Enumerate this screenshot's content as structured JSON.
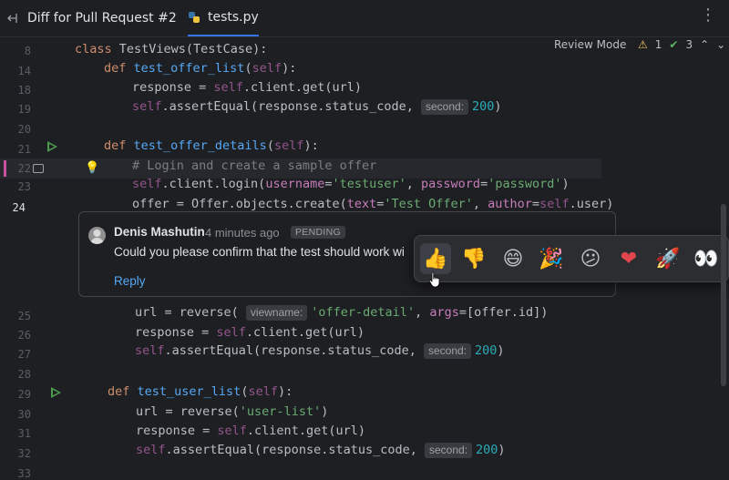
{
  "tabs": [
    {
      "label": "Diff for Pull Request #2"
    },
    {
      "label": "tests.py"
    }
  ],
  "toolbar": {
    "review_mode": "Review Mode",
    "warnings": "1",
    "checks": "3"
  },
  "lines": [
    {
      "n": "8",
      "code": "class TestViews(TestCase):"
    },
    {
      "n": "14",
      "code": "def test_offer_list(self):"
    },
    {
      "n": "18",
      "code": "response = self.client.get(url)"
    },
    {
      "n": "19",
      "code": "self.assertEqual(response.status_code, second: 200)"
    },
    {
      "n": "20",
      "code": ""
    },
    {
      "n": "21",
      "code": "def test_offer_details(self):"
    },
    {
      "n": "22",
      "code": "# Login and create a sample offer"
    },
    {
      "n": "23",
      "code": "self.client.login(username='testuser', password='password')"
    },
    {
      "n": "24",
      "code": "offer = Offer.objects.create(text='Test Offer', author=self.user)"
    },
    {
      "n": "25",
      "code": "url = reverse( viewname: 'offer-detail', args=[offer.id])"
    },
    {
      "n": "26",
      "code": "response = self.client.get(url)"
    },
    {
      "n": "27",
      "code": "self.assertEqual(response.status_code, second: 200)"
    },
    {
      "n": "28",
      "code": ""
    },
    {
      "n": "29",
      "code": "def test_user_list(self):"
    },
    {
      "n": "30",
      "code": "url = reverse('user-list')"
    },
    {
      "n": "31",
      "code": "response = self.client.get(url)"
    },
    {
      "n": "32",
      "code": "self.assertEqual(response.status_code, second: 200)"
    },
    {
      "n": "33",
      "code": ""
    }
  ],
  "comment": {
    "author": "Denis Mashutin",
    "time": "4 minutes ago",
    "status": "PENDING",
    "text": "Could you please confirm that the test should work wi",
    "reply": "Reply"
  },
  "reactions": [
    "thumbs-up",
    "thumbs-down",
    "grinning",
    "party-popper",
    "confused",
    "heart",
    "rocket",
    "eyes"
  ],
  "colors": {
    "accent": "#3574f0",
    "keyword": "#cf8e6d",
    "function": "#56a8f5",
    "string": "#6aab73",
    "number": "#2aacb8",
    "self": "#94558d",
    "marker": "#c94f9f"
  }
}
